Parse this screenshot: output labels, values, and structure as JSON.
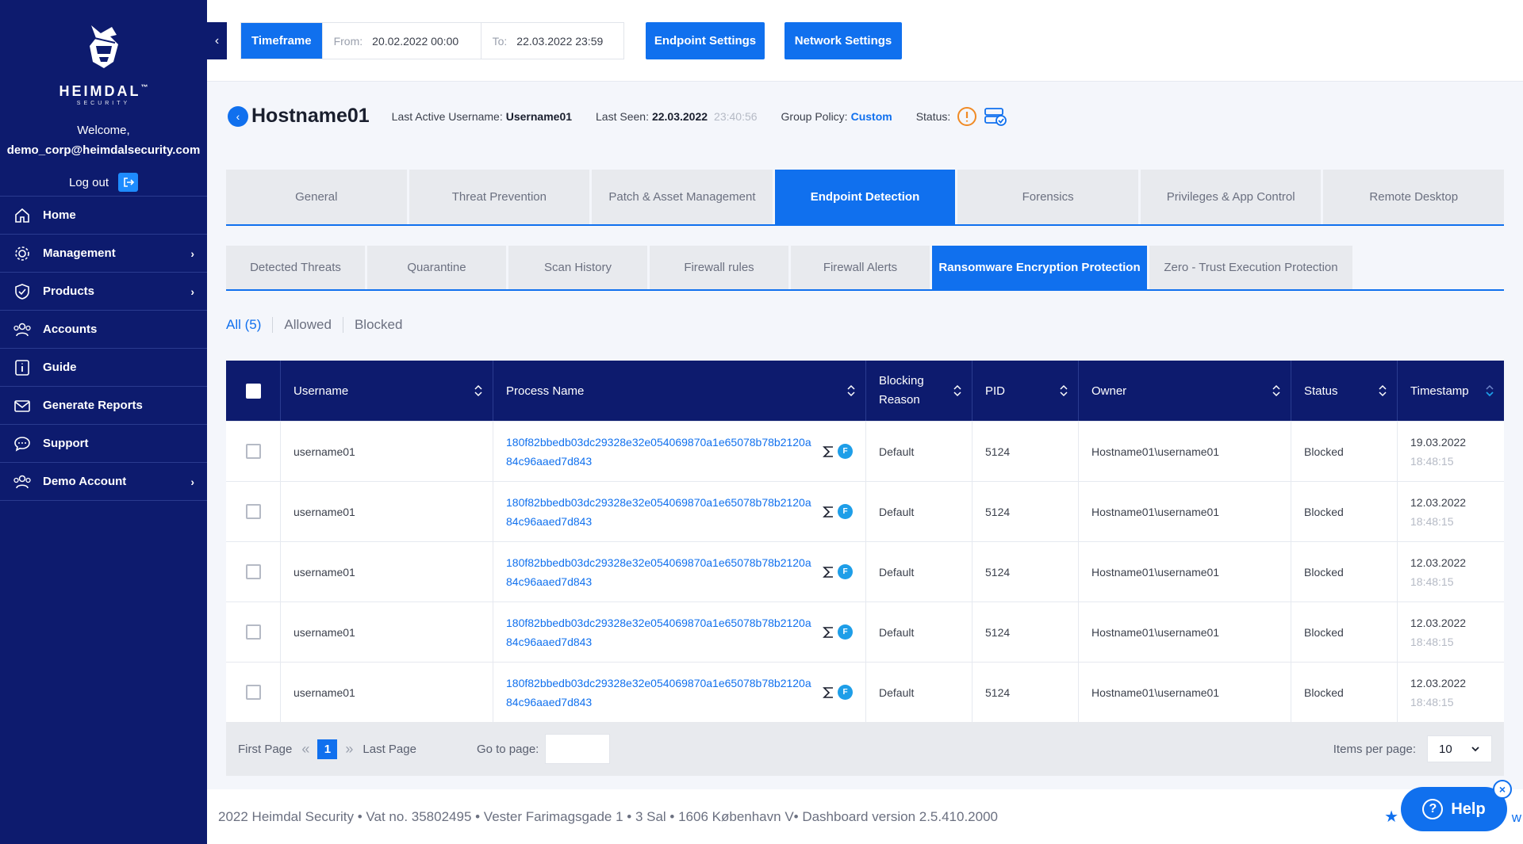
{
  "sidebar": {
    "brand": "HEIMDAL",
    "brand_tm": "™",
    "brand_sub": "SECURITY",
    "welcome": "Welcome,",
    "email": "demo_corp@heimdalsecurity.com",
    "logout": "Log out",
    "items": [
      {
        "label": "Home",
        "icon": "home-icon"
      },
      {
        "label": "Management",
        "icon": "gear-icon"
      },
      {
        "label": "Products",
        "icon": "shield-icon"
      },
      {
        "label": "Accounts",
        "icon": "users-icon"
      },
      {
        "label": "Guide",
        "icon": "info-icon"
      },
      {
        "label": "Generate Reports",
        "icon": "mail-icon"
      },
      {
        "label": "Support",
        "icon": "chat-icon"
      },
      {
        "label": "Demo Account",
        "icon": "users-icon"
      }
    ]
  },
  "topbar": {
    "timeframe_label": "Timeframe",
    "from_label": "From:",
    "from_value": "20.02.2022 00:00",
    "to_label": "To:",
    "to_value": "22.03.2022 23:59",
    "endpoint_settings": "Endpoint Settings",
    "network_settings": "Network Settings"
  },
  "host": {
    "title": "Hostname01",
    "last_active_label": "Last Active Username:",
    "last_active_value": "Username01",
    "last_seen_label": "Last Seen:",
    "last_seen_date": "22.03.2022",
    "last_seen_time": "23:40:56",
    "group_policy_label": "Group Policy:",
    "group_policy_value": "Custom",
    "status_label": "Status:"
  },
  "tabs": [
    "General",
    "Threat Prevention",
    "Patch & Asset Management",
    "Endpoint Detection",
    "Forensics",
    "Privileges & App Control",
    "Remote Desktop"
  ],
  "subtabs": [
    "Detected Threats",
    "Quarantine",
    "Scan History",
    "Firewall rules",
    "Firewall Alerts",
    "Ransomware Encryption Protection",
    "Zero - Trust Execution Protection"
  ],
  "filters": [
    "All (5)",
    "Allowed",
    "Blocked"
  ],
  "table": {
    "headers": [
      "Username",
      "Process Name",
      "Blocking Reason",
      "PID",
      "Owner",
      "Status",
      "Timestamp"
    ],
    "rows": [
      {
        "username": "username01",
        "process": "180f82bbedb03dc29328e32e054069870a1e65078b78b2120a84c96aaed7d843",
        "reason": "Default",
        "pid": "5124",
        "owner": "Hostname01\\username01",
        "status": "Blocked",
        "date": "19.03.2022",
        "time": "18:48:15"
      },
      {
        "username": "username01",
        "process": "180f82bbedb03dc29328e32e054069870a1e65078b78b2120a84c96aaed7d843",
        "reason": "Default",
        "pid": "5124",
        "owner": "Hostname01\\username01",
        "status": "Blocked",
        "date": "12.03.2022",
        "time": "18:48:15"
      },
      {
        "username": "username01",
        "process": "180f82bbedb03dc29328e32e054069870a1e65078b78b2120a84c96aaed7d843",
        "reason": "Default",
        "pid": "5124",
        "owner": "Hostname01\\username01",
        "status": "Blocked",
        "date": "12.03.2022",
        "time": "18:48:15"
      },
      {
        "username": "username01",
        "process": "180f82bbedb03dc29328e32e054069870a1e65078b78b2120a84c96aaed7d843",
        "reason": "Default",
        "pid": "5124",
        "owner": "Hostname01\\username01",
        "status": "Blocked",
        "date": "12.03.2022",
        "time": "18:48:15"
      },
      {
        "username": "username01",
        "process": "180f82bbedb03dc29328e32e054069870a1e65078b78b2120a84c96aaed7d843",
        "reason": "Default",
        "pid": "5124",
        "owner": "Hostname01\\username01",
        "status": "Blocked",
        "date": "12.03.2022",
        "time": "18:48:15"
      }
    ],
    "badge": "F"
  },
  "pager": {
    "first": "First Page",
    "page": "1",
    "last": "Last Page",
    "goto": "Go to page:",
    "ipp_label": "Items per page:",
    "ipp_value": "10"
  },
  "footer": "2022 Heimdal Security • Vat no. 35802495 • Vester Farimagsgade 1 • 3 Sal • 1606 København V• Dashboard version 2.5.410.2000",
  "help": "Help",
  "peek": "w",
  "colors": {
    "navy": "#0d1b6e",
    "accent": "#1070ee",
    "warning": "#f08a24"
  }
}
